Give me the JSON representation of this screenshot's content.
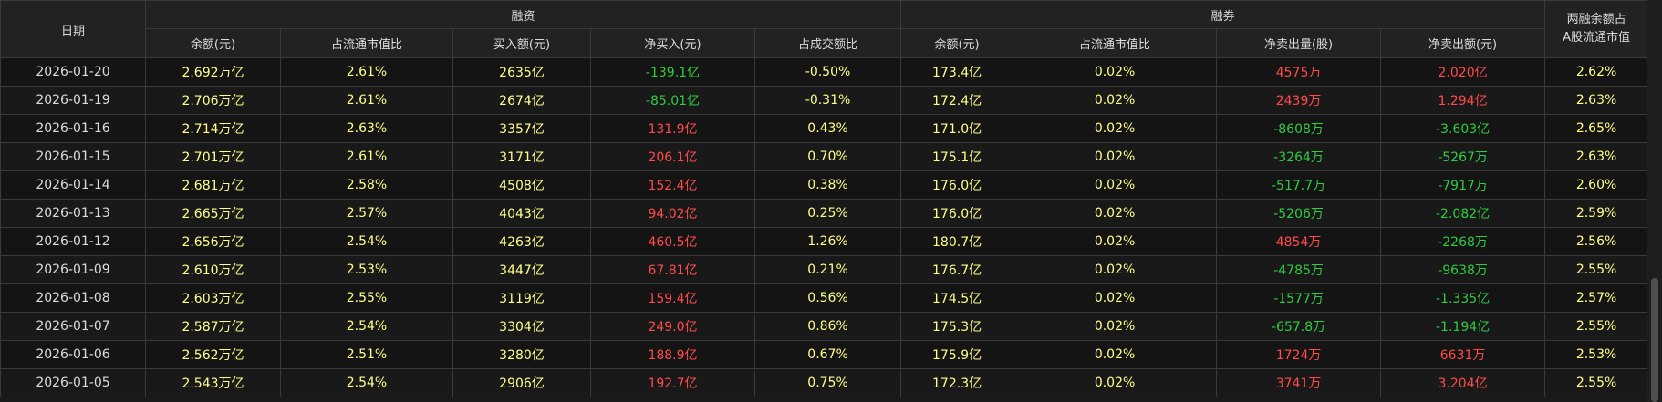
{
  "headers": {
    "date": "日期",
    "margin_financing": "融资",
    "securities_lending": "融券",
    "ratio_line1": "两融余额占",
    "ratio_line2": "A股流通市值"
  },
  "sub_headers": {
    "financing": [
      "余额(元)",
      "占流通市值比",
      "买入额(元)",
      "净买入(元)",
      "占成交额比"
    ],
    "lending": [
      "余额(元)",
      "占流通市值比",
      "净卖出量(股)",
      "净卖出额(元)"
    ]
  },
  "colors": {
    "neutral": "#ffff8a",
    "up": "#ff4a4a",
    "down": "#2ecc40"
  },
  "rows": [
    {
      "date": "2026-01-20",
      "fin_balance": "2.692万亿",
      "fin_ratio": "2.61%",
      "fin_buy": "2635亿",
      "fin_net": "-139.1亿",
      "fin_net_dir": "down",
      "fin_turnover": "-0.50%",
      "sec_balance": "173.4亿",
      "sec_ratio": "0.02%",
      "sec_net_vol": "4575万",
      "sec_net_vol_dir": "up",
      "sec_net_amt": "2.020亿",
      "sec_net_amt_dir": "up",
      "total_ratio": "2.62%"
    },
    {
      "date": "2026-01-19",
      "fin_balance": "2.706万亿",
      "fin_ratio": "2.61%",
      "fin_buy": "2674亿",
      "fin_net": "-85.01亿",
      "fin_net_dir": "down",
      "fin_turnover": "-0.31%",
      "sec_balance": "172.4亿",
      "sec_ratio": "0.02%",
      "sec_net_vol": "2439万",
      "sec_net_vol_dir": "up",
      "sec_net_amt": "1.294亿",
      "sec_net_amt_dir": "up",
      "total_ratio": "2.63%"
    },
    {
      "date": "2026-01-16",
      "fin_balance": "2.714万亿",
      "fin_ratio": "2.63%",
      "fin_buy": "3357亿",
      "fin_net": "131.9亿",
      "fin_net_dir": "up",
      "fin_turnover": "0.43%",
      "sec_balance": "171.0亿",
      "sec_ratio": "0.02%",
      "sec_net_vol": "-8608万",
      "sec_net_vol_dir": "down",
      "sec_net_amt": "-3.603亿",
      "sec_net_amt_dir": "down",
      "total_ratio": "2.65%"
    },
    {
      "date": "2026-01-15",
      "fin_balance": "2.701万亿",
      "fin_ratio": "2.61%",
      "fin_buy": "3171亿",
      "fin_net": "206.1亿",
      "fin_net_dir": "up",
      "fin_turnover": "0.70%",
      "sec_balance": "175.1亿",
      "sec_ratio": "0.02%",
      "sec_net_vol": "-3264万",
      "sec_net_vol_dir": "down",
      "sec_net_amt": "-5267万",
      "sec_net_amt_dir": "down",
      "total_ratio": "2.63%"
    },
    {
      "date": "2026-01-14",
      "fin_balance": "2.681万亿",
      "fin_ratio": "2.58%",
      "fin_buy": "4508亿",
      "fin_net": "152.4亿",
      "fin_net_dir": "up",
      "fin_turnover": "0.38%",
      "sec_balance": "176.0亿",
      "sec_ratio": "0.02%",
      "sec_net_vol": "-517.7万",
      "sec_net_vol_dir": "down",
      "sec_net_amt": "-7917万",
      "sec_net_amt_dir": "down",
      "total_ratio": "2.60%"
    },
    {
      "date": "2026-01-13",
      "fin_balance": "2.665万亿",
      "fin_ratio": "2.57%",
      "fin_buy": "4043亿",
      "fin_net": "94.02亿",
      "fin_net_dir": "up",
      "fin_turnover": "0.25%",
      "sec_balance": "176.0亿",
      "sec_ratio": "0.02%",
      "sec_net_vol": "-5206万",
      "sec_net_vol_dir": "down",
      "sec_net_amt": "-2.082亿",
      "sec_net_amt_dir": "down",
      "total_ratio": "2.59%"
    },
    {
      "date": "2026-01-12",
      "fin_balance": "2.656万亿",
      "fin_ratio": "2.54%",
      "fin_buy": "4263亿",
      "fin_net": "460.5亿",
      "fin_net_dir": "up",
      "fin_turnover": "1.26%",
      "sec_balance": "180.7亿",
      "sec_ratio": "0.02%",
      "sec_net_vol": "4854万",
      "sec_net_vol_dir": "up",
      "sec_net_amt": "-2268万",
      "sec_net_amt_dir": "down",
      "total_ratio": "2.56%"
    },
    {
      "date": "2026-01-09",
      "fin_balance": "2.610万亿",
      "fin_ratio": "2.53%",
      "fin_buy": "3447亿",
      "fin_net": "67.81亿",
      "fin_net_dir": "up",
      "fin_turnover": "0.21%",
      "sec_balance": "176.7亿",
      "sec_ratio": "0.02%",
      "sec_net_vol": "-4785万",
      "sec_net_vol_dir": "down",
      "sec_net_amt": "-9638万",
      "sec_net_amt_dir": "down",
      "total_ratio": "2.55%"
    },
    {
      "date": "2026-01-08",
      "fin_balance": "2.603万亿",
      "fin_ratio": "2.55%",
      "fin_buy": "3119亿",
      "fin_net": "159.4亿",
      "fin_net_dir": "up",
      "fin_turnover": "0.56%",
      "sec_balance": "174.5亿",
      "sec_ratio": "0.02%",
      "sec_net_vol": "-1577万",
      "sec_net_vol_dir": "down",
      "sec_net_amt": "-1.335亿",
      "sec_net_amt_dir": "down",
      "total_ratio": "2.57%"
    },
    {
      "date": "2026-01-07",
      "fin_balance": "2.587万亿",
      "fin_ratio": "2.54%",
      "fin_buy": "3304亿",
      "fin_net": "249.0亿",
      "fin_net_dir": "up",
      "fin_turnover": "0.86%",
      "sec_balance": "175.3亿",
      "sec_ratio": "0.02%",
      "sec_net_vol": "-657.8万",
      "sec_net_vol_dir": "down",
      "sec_net_amt": "-1.194亿",
      "sec_net_amt_dir": "down",
      "total_ratio": "2.55%"
    },
    {
      "date": "2026-01-06",
      "fin_balance": "2.562万亿",
      "fin_ratio": "2.51%",
      "fin_buy": "3280亿",
      "fin_net": "188.9亿",
      "fin_net_dir": "up",
      "fin_turnover": "0.67%",
      "sec_balance": "175.9亿",
      "sec_ratio": "0.02%",
      "sec_net_vol": "1724万",
      "sec_net_vol_dir": "up",
      "sec_net_amt": "6631万",
      "sec_net_amt_dir": "up",
      "total_ratio": "2.53%"
    },
    {
      "date": "2026-01-05",
      "fin_balance": "2.543万亿",
      "fin_ratio": "2.54%",
      "fin_buy": "2906亿",
      "fin_net": "192.7亿",
      "fin_net_dir": "up",
      "fin_turnover": "0.75%",
      "sec_balance": "172.3亿",
      "sec_ratio": "0.02%",
      "sec_net_vol": "3741万",
      "sec_net_vol_dir": "up",
      "sec_net_amt": "3.204亿",
      "sec_net_amt_dir": "up",
      "total_ratio": "2.55%"
    }
  ]
}
